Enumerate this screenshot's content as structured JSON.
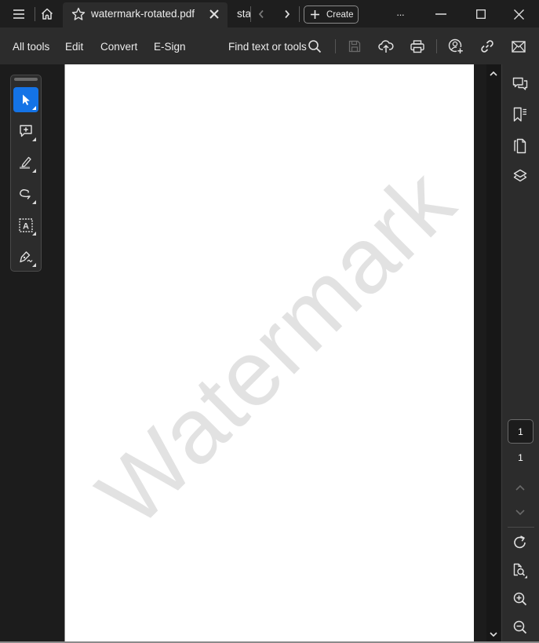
{
  "titlebar": {
    "menu_icon": "hamburger-menu-icon",
    "home_icon": "home-icon",
    "active_tab": {
      "title": "watermark-rotated.pdf",
      "star_icon": "star-icon",
      "close_icon": "close-icon"
    },
    "inactive_tab": {
      "title": "sta"
    },
    "nav": {
      "prev_icon": "chevron-left-icon",
      "next_icon": "chevron-right-icon"
    },
    "create_label": "Create",
    "more_label": "···",
    "window_controls": [
      "minimize",
      "maximize",
      "close"
    ]
  },
  "toolbar": {
    "menu": [
      "All tools",
      "Edit",
      "Convert",
      "E-Sign"
    ],
    "find_label": "Find text or tools",
    "icons": [
      "search-icon",
      "save-icon",
      "upload-cloud-icon",
      "print-icon",
      "share-user-icon",
      "link-icon",
      "email-icon"
    ]
  },
  "quick_tools": {
    "items": [
      {
        "name": "select",
        "active": true
      },
      {
        "name": "add-comment",
        "active": false
      },
      {
        "name": "highlight",
        "active": false
      },
      {
        "name": "draw-freeform",
        "active": false
      },
      {
        "name": "text-box",
        "active": false
      },
      {
        "name": "sign",
        "active": false
      }
    ]
  },
  "document": {
    "watermark_text": "Watermark"
  },
  "right_panel": {
    "icons": [
      "comments-icon",
      "bookmarks-icon",
      "pages-icon",
      "layers-icon"
    ],
    "current_page": "1",
    "total_pages": "1",
    "bottom_icons": [
      "rotate-icon",
      "page-zoom-icon",
      "zoom-in-icon",
      "zoom-out-icon"
    ]
  },
  "colors": {
    "accent": "#1473e6",
    "titlebar_bg": "#1e1e1e",
    "toolbar_bg": "#2c2c2c",
    "page_bg": "#ffffff",
    "watermark": "#e2e2e2"
  }
}
